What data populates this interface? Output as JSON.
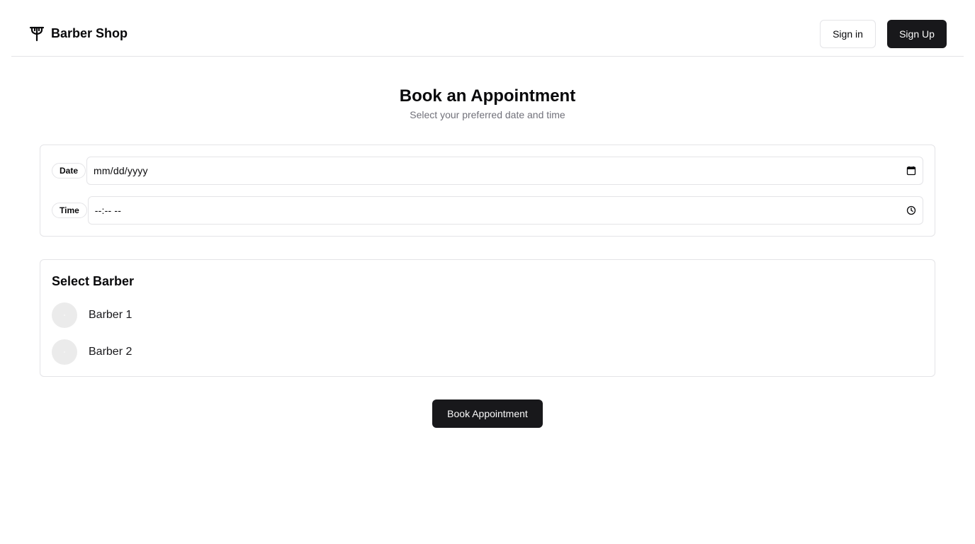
{
  "header": {
    "brand_name": "Barber Shop",
    "brand_icon": "scissors-icon",
    "sign_in_label": "Sign in",
    "sign_up_label": "Sign Up"
  },
  "page": {
    "title": "Book an Appointment",
    "subtitle": "Select your preferred date and time"
  },
  "datetime": {
    "date_label": "Date",
    "date_value": "mm/dd/yyyy",
    "date_icon": "calendar-icon",
    "time_label": "Time",
    "time_value": "--:-- --",
    "time_icon": "clock-icon"
  },
  "barbers": {
    "title": "Select Barber",
    "items": [
      {
        "name": "Barber 1",
        "avatar": "avatar-placeholder"
      },
      {
        "name": "Barber 2",
        "avatar": "avatar-placeholder"
      }
    ]
  },
  "actions": {
    "book_label": "Book Appointment"
  },
  "colors": {
    "primary": "#18181b",
    "border": "#e4e4e7",
    "muted_text": "#71717a",
    "avatar_bg": "#ebebeb"
  }
}
